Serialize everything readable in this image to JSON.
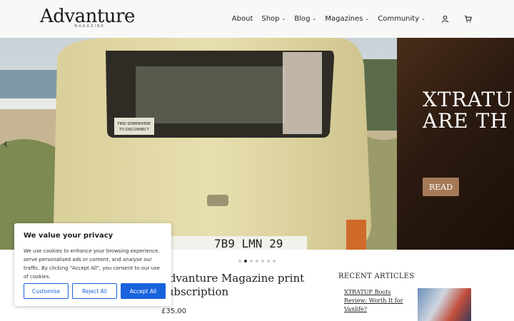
{
  "header": {
    "logo": "Advanture",
    "logo_sub": "MAGAZINE",
    "nav": [
      {
        "label": "About",
        "dropdown": false
      },
      {
        "label": "Shop",
        "dropdown": true
      },
      {
        "label": "Blog",
        "dropdown": true
      },
      {
        "label": "Magazines",
        "dropdown": true
      },
      {
        "label": "Community",
        "dropdown": true
      }
    ],
    "icons": [
      "user-icon",
      "cart-icon"
    ]
  },
  "hero": {
    "slide2_headline_line1": "XTRATUF",
    "slide2_headline_line2": "ARE TH",
    "read_label": "READ",
    "prev_arrow": "‹",
    "next_arrow": "›",
    "dots_count": 7,
    "active_dot": 1,
    "van_plate": "7B9 LMN 29",
    "van_sign": "FIND SOMEWHERE TO DISCONNECT"
  },
  "product": {
    "title": "Advanture Magazine print subscription",
    "price": "£35,00"
  },
  "sidebar": {
    "recent_title": "RECENT ARTICLES",
    "articles": [
      {
        "title": "XTRATUF Boots Review: Worth It for Vanlife?"
      }
    ]
  },
  "cookie": {
    "title": "We value your privacy",
    "text": "We use cookies to enhance your browsing experience, serve personalised ads or content, and analyse our traffic. By clicking \"Accept All\", you consent to our use of cookies.",
    "customise": "Customise",
    "reject": "Reject All",
    "accept": "Accept All",
    "accent": "#1863dc"
  }
}
